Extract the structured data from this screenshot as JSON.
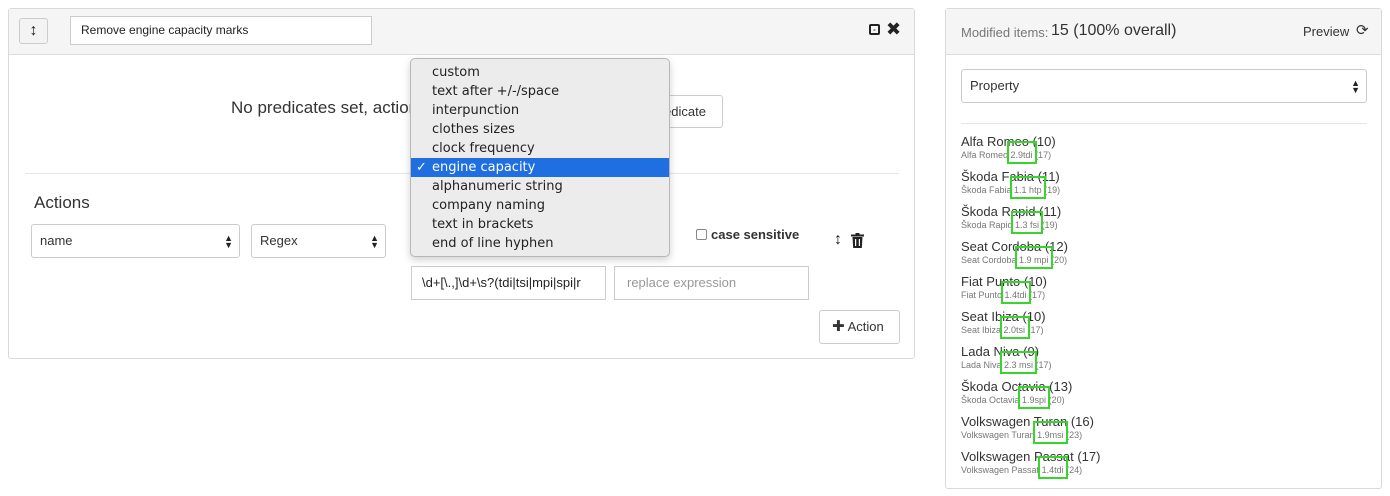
{
  "rule": {
    "name_value": "Remove engine capacity marks",
    "no_predicates_text": "No predicates set, action",
    "add_predicate_label": "edicate",
    "actions_title": "Actions",
    "property_select": "name",
    "type_select": "Regex",
    "case_sensitive_label": "case sensitive",
    "regex_value": "\\d+[\\.,]\\d+\\s?(tdi|tsi|mpi|spi|r",
    "replace_placeholder": "replace expression",
    "add_action_label": "Action"
  },
  "dropdown": {
    "items": [
      {
        "label": "custom",
        "selected": false
      },
      {
        "label": "text after +/-/space",
        "selected": false
      },
      {
        "label": "interpunction",
        "selected": false
      },
      {
        "label": "clothes sizes",
        "selected": false
      },
      {
        "label": "clock frequency",
        "selected": false
      },
      {
        "label": "engine capacity",
        "selected": true
      },
      {
        "label": "alphanumeric string",
        "selected": false
      },
      {
        "label": "company naming",
        "selected": false
      },
      {
        "label": "text in brackets",
        "selected": false
      },
      {
        "label": "end of line hyphen",
        "selected": false
      }
    ]
  },
  "preview": {
    "modified_label": "Modified items:",
    "modified_value": "15 (100% overall)",
    "preview_label": "Preview",
    "property_select": "Property",
    "items": [
      {
        "title": "Alfa Romeo (10)",
        "prefix": "Alfa Romeo",
        "match": "2.9tdi",
        "suffix": "(17)"
      },
      {
        "title": "Škoda Fabia (11)",
        "prefix": "Škoda Fabia",
        "match": "1.1 htp",
        "suffix": "(19)"
      },
      {
        "title": "Škoda Rapid (11)",
        "prefix": "Škoda Rapid",
        "match": "1.3 fsi",
        "suffix": "(19)"
      },
      {
        "title": "Seat Cordoba (12)",
        "prefix": "Seat Cordoba",
        "match": "1.9 mpi",
        "suffix": "(20)"
      },
      {
        "title": "Fiat Punto (10)",
        "prefix": "Fiat Punto",
        "match": "1.4tdi",
        "suffix": "(17)"
      },
      {
        "title": "Seat Ibiza (10)",
        "prefix": "Seat Ibiza",
        "match": "2.0tsi",
        "suffix": "(17)"
      },
      {
        "title": "Lada Niva (9)",
        "prefix": "Lada Niva",
        "match": "2.3 msi",
        "suffix": "(17)"
      },
      {
        "title": "Škoda Octavia (13)",
        "prefix": "Škoda Octavia",
        "match": "1.9spi",
        "suffix": "(20)"
      },
      {
        "title": "Volkswagen Turan (16)",
        "prefix": "Volkswagen Turan",
        "match": "1.9msi",
        "suffix": "(23)"
      },
      {
        "title": "Volkswagen Passat (17)",
        "prefix": "Volkswagen Passat",
        "match": "1.4tdi",
        "suffix": "(24)"
      }
    ]
  },
  "colors": {
    "highlight": "#37d52e",
    "dropdown_selected": "#1f6fe0"
  }
}
